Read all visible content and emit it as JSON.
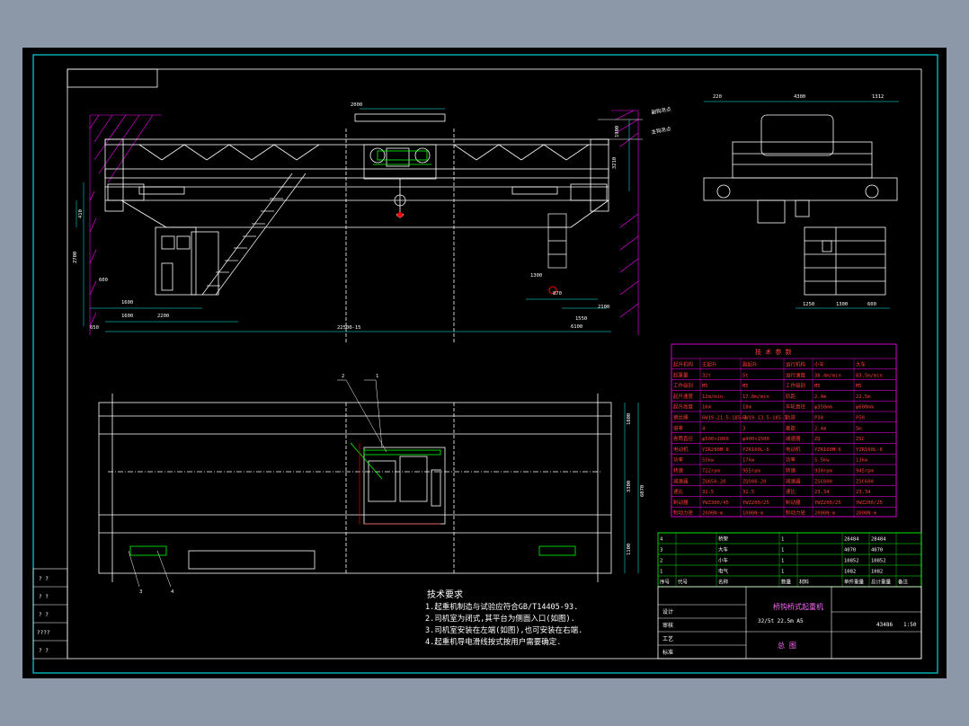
{
  "drawing": {
    "dims_main_view": [
      "2000",
      "1600",
      "2200",
      "22500-15",
      "650",
      "1550",
      "600",
      "870",
      "1300",
      "6100",
      "2100",
      "3210",
      "1900",
      "410",
      "2700",
      "1600"
    ],
    "dims_side_view": [
      "220",
      "4300",
      "1312",
      "1250",
      "1300",
      "600"
    ],
    "dims_plan_view": [
      "1800",
      "3300",
      "6070",
      "1100"
    ],
    "callouts": [
      "1",
      "2",
      "3",
      "4"
    ],
    "level_labels": [
      "副钩吊点",
      "主钩吊点"
    ]
  },
  "tech_requirements": {
    "title": "技术要求",
    "lines": [
      "1.起重机制造与试验应符合GB/T14405-93.",
      "2.司机室为闭式,其平台为侧面入口(如图).",
      "3.司机室安装在左端(如图),也可安装在右端.",
      "4.起重机导电滑线按式按用户需要确定."
    ]
  },
  "tech_params": {
    "title": "技 术 参 数",
    "header": [
      "起升机构",
      "主起升",
      "副起升",
      "运行机构",
      "小车",
      "大车"
    ],
    "rows": [
      [
        "起重量",
        "32t",
        "5t",
        "运行速度",
        "38.4m/min",
        "83.5m/min"
      ],
      [
        "工作级别",
        "M5",
        "M5",
        "工作级别",
        "M5",
        "M5"
      ],
      [
        "起升速度",
        "12m/min",
        "17.8m/min",
        "轨距",
        "2.4m",
        "22.5m"
      ],
      [
        "起升高度",
        "16m",
        "18m",
        "车轮直径",
        "φ350mm",
        "φ600mm"
      ],
      [
        "钢丝绳",
        "6W19-21.5-185-I",
        "6W19-13.5-185-I",
        "轨道",
        "P38",
        "P50"
      ],
      [
        "倍率",
        "4",
        "3",
        "基距",
        "2.4m",
        "5m"
      ],
      [
        "卷筒直径",
        "φ500×2800",
        "φ400×1500",
        "减速器",
        "ZQ",
        "ZSC"
      ],
      [
        "电动机",
        "YZR280M-8",
        "YZR160L-6",
        "电动机",
        "YZR160M-6",
        "YZR160L-6"
      ],
      [
        "功率",
        "55kw",
        "17kw",
        "功率",
        "5.5kw",
        "13kw"
      ],
      [
        "转速",
        "722rpm",
        "955rpm",
        "转速",
        "930rpm",
        "945rpm"
      ],
      [
        "减速器",
        "ZQ650-20",
        "ZQ500-20",
        "减速器",
        "ZSC600",
        "ZSC600"
      ],
      [
        "速比",
        "31.5",
        "31.5",
        "速比",
        "23.34",
        "23.34"
      ],
      [
        "制动器",
        "YWZ300/45",
        "YWZ200/25",
        "制动器",
        "YWZ200/25",
        "YWZ200/25"
      ],
      [
        "制动力矩",
        "2000N·m",
        "1000N·m",
        "制动力矩",
        "2000N·m",
        "2000N·m"
      ]
    ]
  },
  "bom": {
    "header": [
      "序号",
      "代号",
      "名称",
      "数量",
      "材料",
      "单件重量",
      "总计重量",
      "备注"
    ],
    "rows": [
      [
        "4",
        "",
        "桥架",
        "1",
        "",
        "28484",
        "28484",
        ""
      ],
      [
        "3",
        "",
        "大车",
        "1",
        "",
        "4070",
        "4070",
        ""
      ],
      [
        "2",
        "",
        "小车",
        "1",
        "",
        "10852",
        "10852",
        ""
      ],
      [
        "1",
        "",
        "电气",
        "1",
        "",
        "1082",
        "1082",
        ""
      ]
    ],
    "weight_label": "重量(kg)"
  },
  "title_block": {
    "name": "桥钩桥式起重机",
    "spec": "32/5t  22.5m  A5",
    "drawing_title": "总 图",
    "weight": "43486",
    "scale": "1:50",
    "left_labels": [
      "? ?",
      "? ?",
      "? ?",
      "????",
      "? ?"
    ],
    "sig_labels": [
      "设计",
      "审核",
      "工艺",
      "标准"
    ]
  },
  "colors": {
    "background": "#8c97a7",
    "sheet": "#000000",
    "frame": "#00ffff",
    "structure": "#ffffff",
    "dimension": "#00ffff",
    "hatch": "#ff00ff",
    "table_line": "#ff00ff",
    "bom_line": "#00ff00",
    "table_text": "#ff3b3b",
    "green": "#00ff00",
    "red": "#ff0000",
    "notes_text": "#ffffff"
  }
}
